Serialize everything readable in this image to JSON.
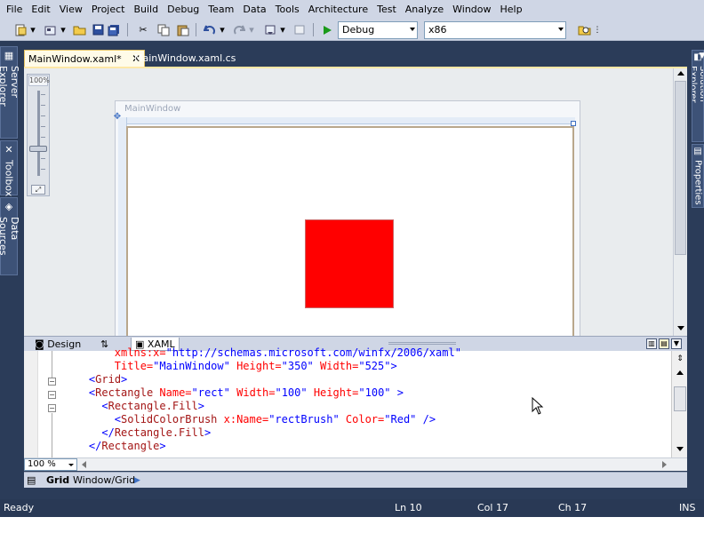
{
  "menu": [
    "File",
    "Edit",
    "View",
    "Project",
    "Build",
    "Debug",
    "Team",
    "Data",
    "Tools",
    "Architecture",
    "Test",
    "Analyze",
    "Window",
    "Help"
  ],
  "toolbar": {
    "config": "Debug",
    "platform": "x86"
  },
  "left_tabs": [
    "Server Explorer",
    "Toolbox",
    "Data Sources"
  ],
  "right_tabs": [
    "Solution Explorer",
    "Properties"
  ],
  "doc_tabs": [
    {
      "label": "MainWindow.xaml*",
      "active": true
    },
    {
      "label": "MainWindow.xaml.cs",
      "active": false
    }
  ],
  "designer": {
    "zoom_label": "100%",
    "window_title": "MainWindow",
    "rect_color": "#ff0000"
  },
  "split_tabs": {
    "design": "Design",
    "swap": "⇅",
    "xaml": "XAML"
  },
  "code_lines": [
    {
      "indent": "        ",
      "parts": [
        [
          "at",
          "xmlns:x="
        ],
        [
          "av",
          "\"http://schemas.microsoft.com/winfx/2006/xaml\""
        ]
      ]
    },
    {
      "indent": "        ",
      "parts": [
        [
          "at",
          "Title="
        ],
        [
          "av",
          "\"MainWindow\""
        ],
        [
          "at",
          " Height="
        ],
        [
          "av",
          "\"350\""
        ],
        [
          "at",
          " Width="
        ],
        [
          "av",
          "\"525\""
        ],
        [
          "br",
          ">"
        ]
      ]
    },
    {
      "indent": "    ",
      "parts": [
        [
          "br",
          "<"
        ],
        [
          "tg",
          "Grid"
        ],
        [
          "br",
          ">"
        ]
      ]
    },
    {
      "indent": "    ",
      "parts": [
        [
          "br",
          "<"
        ],
        [
          "tg",
          "Rectangle"
        ],
        [
          "at",
          " Name="
        ],
        [
          "av",
          "\"rect\""
        ],
        [
          "at",
          " Width="
        ],
        [
          "av",
          "\"100\""
        ],
        [
          "at",
          " Height="
        ],
        [
          "av",
          "\"100\""
        ],
        [
          "br",
          " >"
        ]
      ]
    },
    {
      "indent": "      ",
      "parts": [
        [
          "br",
          "<"
        ],
        [
          "tg",
          "Rectangle.Fill"
        ],
        [
          "br",
          ">"
        ]
      ]
    },
    {
      "indent": "        ",
      "parts": [
        [
          "br",
          "<"
        ],
        [
          "tg",
          "SolidColorBrush"
        ],
        [
          "at",
          " x:Name="
        ],
        [
          "av",
          "\"rectBrush\""
        ],
        [
          "at",
          " Color="
        ],
        [
          "av",
          "\"Red\""
        ],
        [
          "br",
          " />"
        ]
      ]
    },
    {
      "indent": "      ",
      "parts": [
        [
          "br",
          "</"
        ],
        [
          "tg",
          "Rectangle.Fill"
        ],
        [
          "br",
          ">"
        ]
      ]
    },
    {
      "indent": "    ",
      "parts": [
        [
          "br",
          "</"
        ],
        [
          "tg",
          "Rectangle"
        ],
        [
          "br",
          ">"
        ]
      ]
    }
  ],
  "editor_zoom": "100 %",
  "path": {
    "root": "Grid",
    "child": "Window/Grid"
  },
  "status": {
    "state": "Ready",
    "ln": "Ln 10",
    "col": "Col 17",
    "ch": "Ch 17",
    "mode": "INS"
  }
}
